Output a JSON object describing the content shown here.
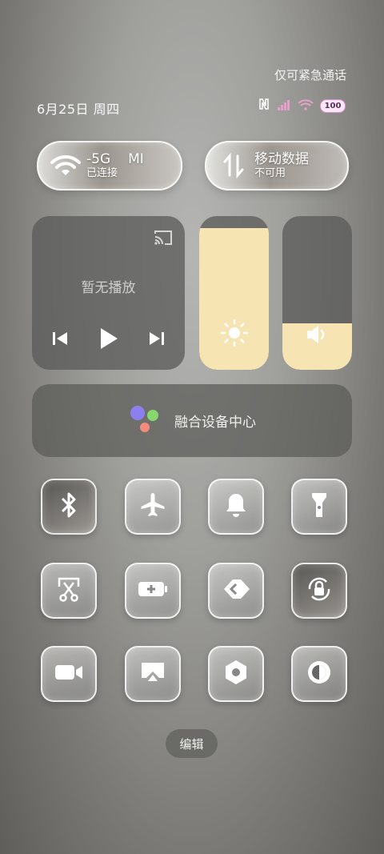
{
  "status_bar": {
    "emergency_text": "仅可紧急通话",
    "datetime": "6月25日 周四",
    "battery_level": "100"
  },
  "wifi_tile": {
    "ssid": "-5G",
    "ssid_tail": "MI",
    "status": "已连接"
  },
  "data_tile": {
    "title": "移动数据",
    "status": "不可用"
  },
  "media": {
    "title": "暂无播放"
  },
  "brightness": {
    "level": 0.92
  },
  "volume": {
    "level": 0.3
  },
  "device_center": {
    "label": "融合设备中心"
  },
  "toggles": [
    {
      "icon": "bluetooth-icon"
    },
    {
      "icon": "airplane-icon"
    },
    {
      "icon": "bell-icon"
    },
    {
      "icon": "flashlight-icon"
    },
    {
      "icon": "screenshot-icon"
    },
    {
      "icon": "battery-saver-icon"
    },
    {
      "icon": "link-icon"
    },
    {
      "icon": "rotation-lock-icon"
    },
    {
      "icon": "video-icon"
    },
    {
      "icon": "screen-cast-icon"
    },
    {
      "icon": "settings-icon"
    },
    {
      "icon": "dark-mode-icon"
    }
  ],
  "edit_label": "编辑",
  "colors": {
    "slider_fill": "#f6e4b3",
    "battery_border": "#e48bd2"
  }
}
